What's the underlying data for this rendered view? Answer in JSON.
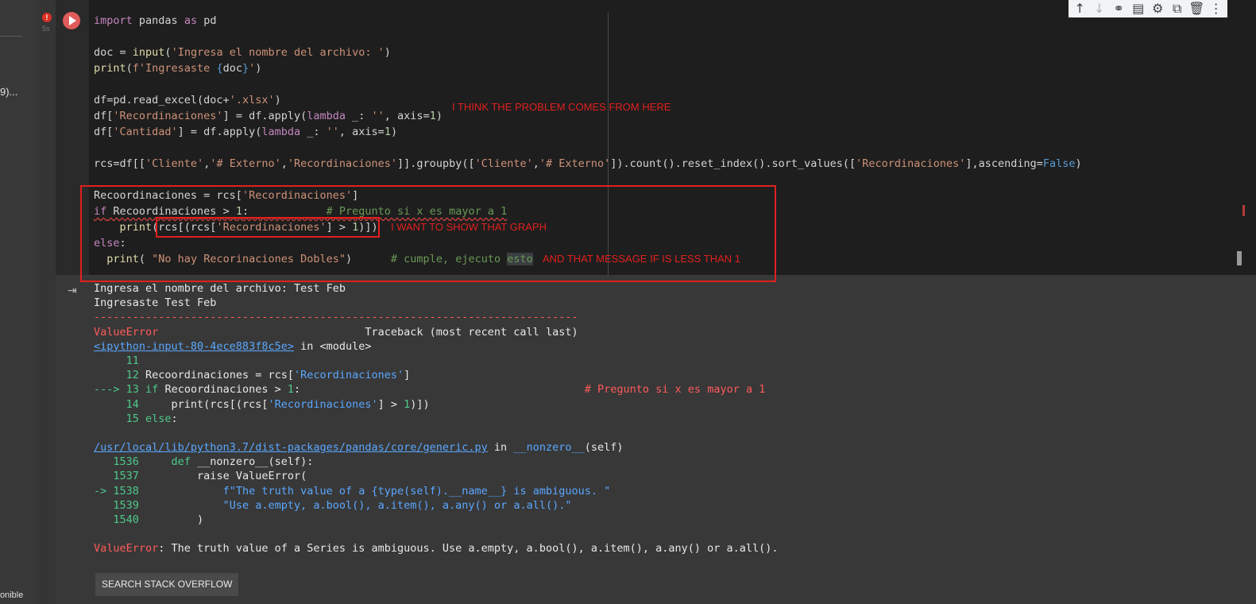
{
  "sidebar": {
    "truncated_label": "9)...",
    "bottom_label": "onible"
  },
  "cell": {
    "error_badge": "!",
    "exec_time": "5s",
    "code_lines": [
      "import pandas as pd",
      "",
      "doc = input('Ingresa el nombre del archivo: ')",
      "print(f'Ingresaste {doc}')",
      "",
      "df=pd.read_excel(doc+'.xlsx')",
      "df['Recordinaciones'] = df.apply(lambda _: '', axis=1)",
      "df['Cantidad'] = df.apply(lambda _: '', axis=1)",
      "",
      "rcs=df[['Cliente','# Externo','Recordinaciones']].groupby(['Cliente','# Externo']).count().reset_index().sort_values(['Recordinaciones'],ascending=False)",
      "",
      "Recoordinaciones = rcs['Recordinaciones']",
      "if Recoordinaciones > 1:            # Pregunto si x es mayor a 1",
      "    print(rcs[(rcs['Recordinaciones'] > 1)])",
      "else:",
      "  print( \"No hay Recorinaciones Dobles\")      # cumple, ejecuto esto"
    ],
    "annotations": {
      "problem": "I THINK THE PROBLEM COMES FROM HERE",
      "graph": "I WANT TO SHOW THAT GRAPH",
      "message": "AND THAT MESSAGE IF IS LESS THAN 1"
    }
  },
  "toolbar": {
    "icons": [
      "arrow-up-icon",
      "arrow-down-icon",
      "link-icon",
      "comment-icon",
      "gear-icon",
      "mirror-cell-icon",
      "delete-icon",
      "more-icon"
    ]
  },
  "output": {
    "lines": [
      "Ingresa el nombre del archivo: Test Feb",
      "Ingresaste Test Feb",
      "---------------------------------------------------------------------------",
      "ValueError                                Traceback (most recent call last)",
      "<ipython-input-80-4ece883f8c5e> in <module>",
      "     11",
      "     12 Recoordinaciones = rcs['Recordinaciones']",
      "---> 13 if Recoordinaciones > 1:                                            # Pregunto si x es mayor a 1",
      "     14     print(rcs[(rcs['Recordinaciones'] > 1)])",
      "     15 else:",
      "",
      "/usr/local/lib/python3.7/dist-packages/pandas/core/generic.py in __nonzero__(self)",
      "   1536     def __nonzero__(self):",
      "   1537         raise ValueError(",
      "-> 1538             f\"The truth value of a {type(self).__name__} is ambiguous. \"",
      "   1539             \"Use a.empty, a.bool(), a.item(), a.any() or a.all().\"",
      "   1540         )",
      "",
      "ValueError: The truth value of a Series is ambiguous. Use a.empty, a.bool(), a.item(), a.any() or a.all()."
    ],
    "search_button": "SEARCH STACK OVERFLOW"
  }
}
